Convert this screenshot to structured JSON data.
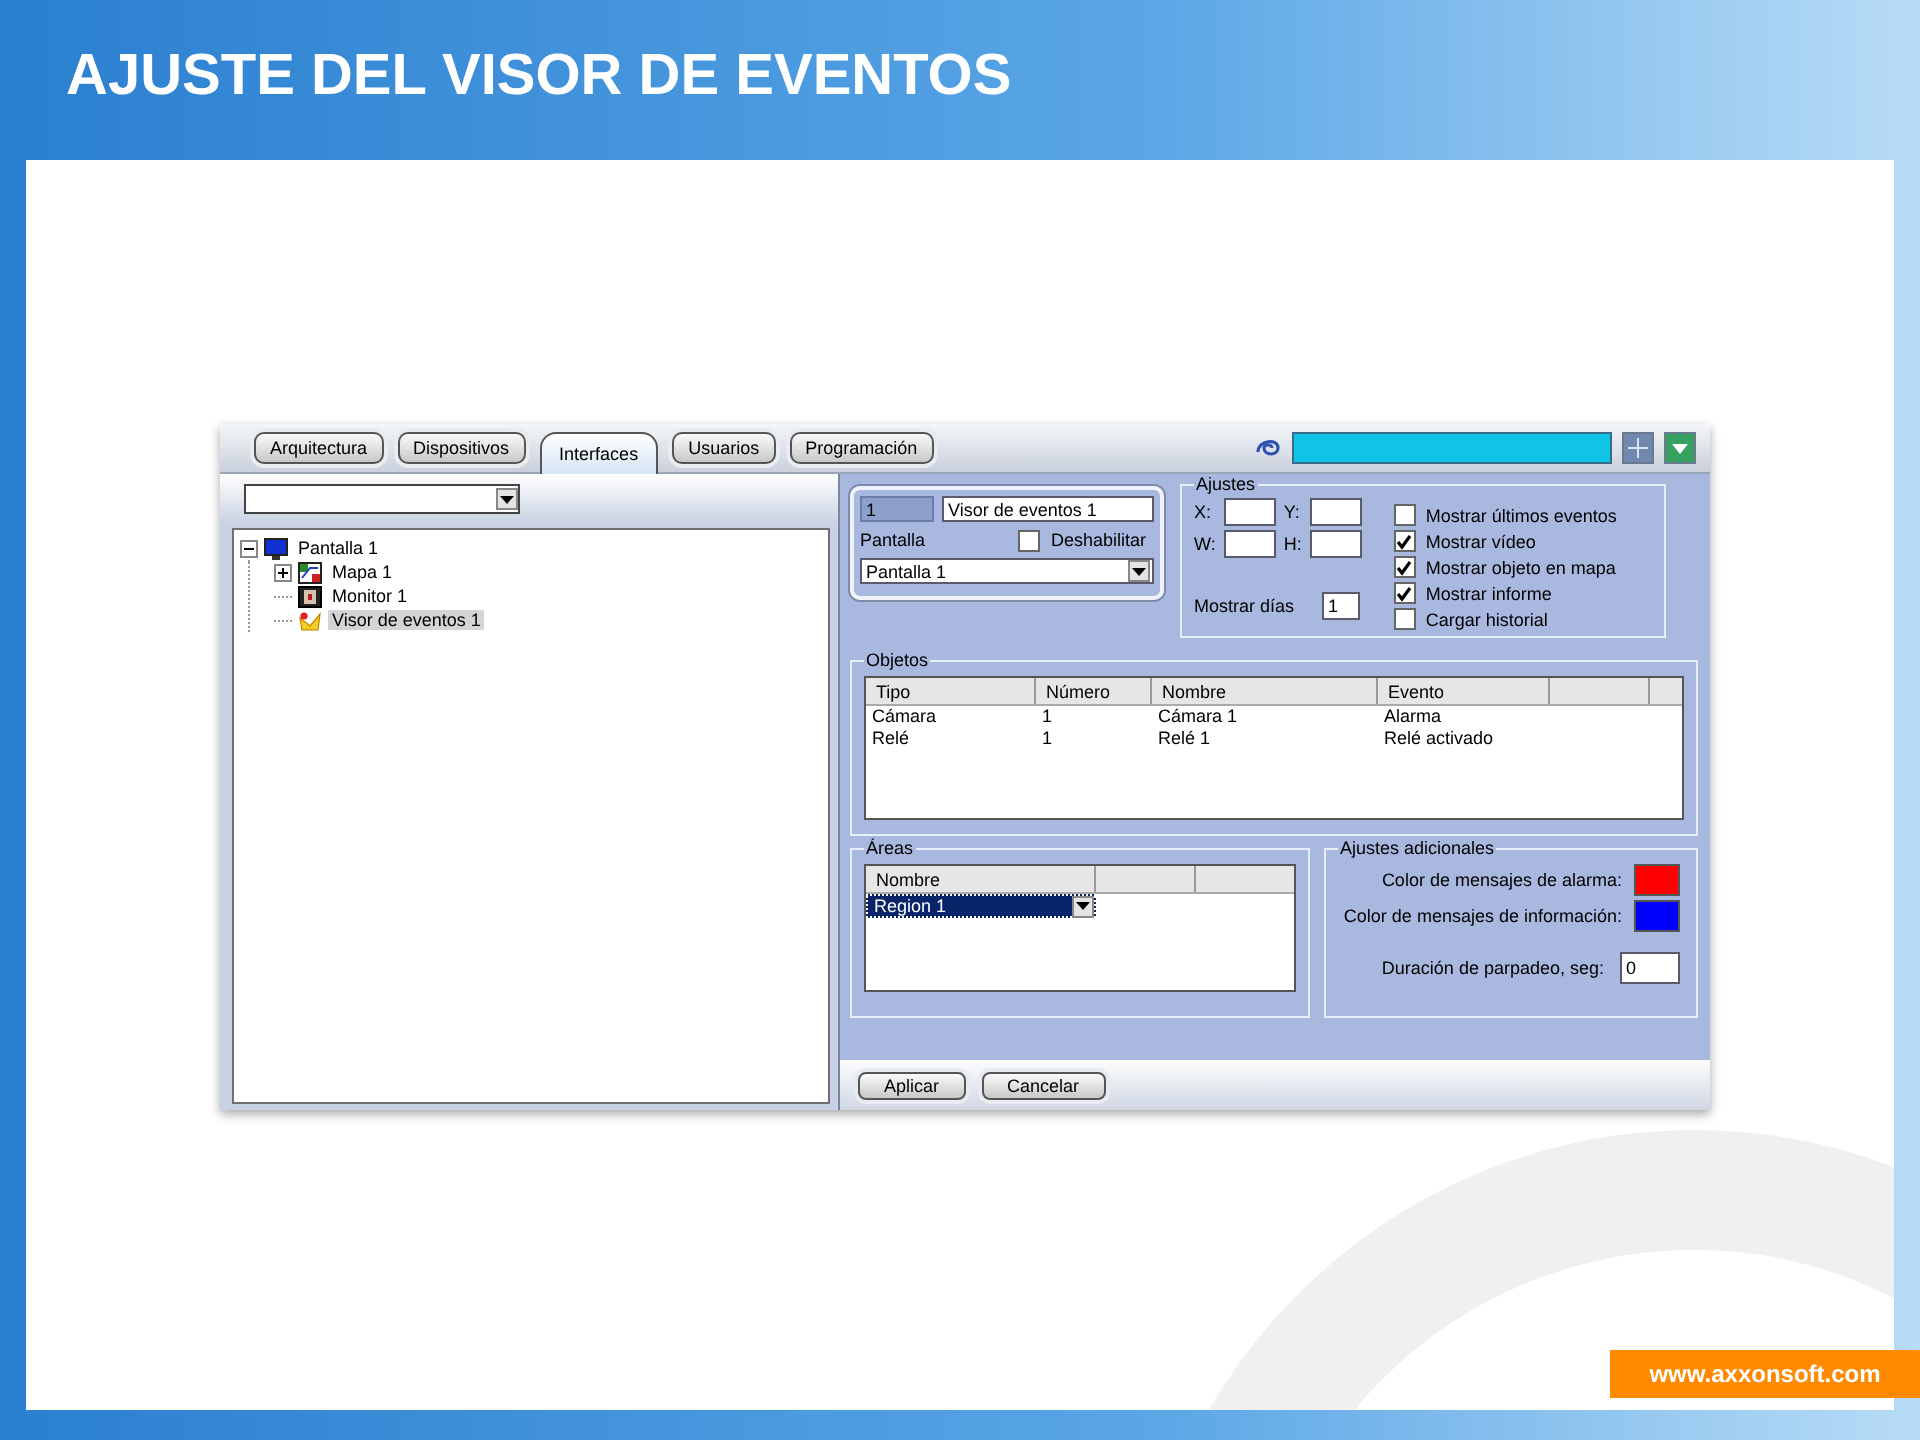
{
  "slide": {
    "title": "AJUSTE DEL VISOR DE EVENTOS",
    "footer_url": "www.axxonsoft.com"
  },
  "tabs": [
    {
      "label": "Arquitectura",
      "selected": false
    },
    {
      "label": "Dispositivos",
      "selected": false
    },
    {
      "label": "Interfaces",
      "selected": true
    },
    {
      "label": "Usuarios",
      "selected": false
    },
    {
      "label": "Programación",
      "selected": false
    }
  ],
  "tree": [
    {
      "label": "Pantalla 1",
      "kind": "screen",
      "expanded": true,
      "selected": false,
      "children": [
        {
          "label": "Mapa 1",
          "kind": "map",
          "expanded": false,
          "selected": false
        },
        {
          "label": "Monitor 1",
          "kind": "monitor",
          "selected": false
        },
        {
          "label": "Visor de eventos 1",
          "kind": "viewer",
          "selected": true
        }
      ]
    }
  ],
  "object": {
    "id": "1",
    "name": "Visor de eventos 1",
    "screen_label": "Pantalla",
    "disable": {
      "label": "Deshabilitar",
      "checked": false
    },
    "screen": "Pantalla 1"
  },
  "ajustes": {
    "title": "Ajustes",
    "coords": [
      {
        "label": "X:"
      },
      {
        "label": "Y:"
      },
      {
        "label": "W:"
      },
      {
        "label": "H:"
      }
    ],
    "days_label": "Mostrar días",
    "days": "1",
    "options": [
      {
        "label": "Mostrar últimos eventos",
        "checked": false
      },
      {
        "label": "Mostrar vídeo",
        "checked": true
      },
      {
        "label": "Mostrar objeto en mapa",
        "checked": true
      },
      {
        "label": "Mostrar informe",
        "checked": true
      },
      {
        "label": "Cargar historial",
        "checked": false
      }
    ]
  },
  "objetos": {
    "title": "Objetos",
    "columns": [
      "Tipo",
      "Número",
      "Nombre",
      "Evento"
    ],
    "rows": [
      [
        "Cámara",
        "1",
        "Cámara 1",
        "Alarma"
      ],
      [
        "Relé",
        "1",
        "Relé 1",
        "Relé activado"
      ]
    ]
  },
  "areas": {
    "title": "Áreas",
    "columns": [
      "Nombre"
    ],
    "rows": [
      {
        "value": "Region 1",
        "selected": true
      }
    ]
  },
  "extra": {
    "title": "Ajustes adicionales",
    "colors": [
      {
        "label": "Color de mensajes de alarma:",
        "color": "#ff0000"
      },
      {
        "label": "Color de mensajes de información:",
        "color": "#0000ff"
      }
    ],
    "blink_label": "Duración de parpadeo, seg:",
    "blink": "0"
  },
  "buttons": [
    "Aplicar",
    "Cancelar"
  ]
}
